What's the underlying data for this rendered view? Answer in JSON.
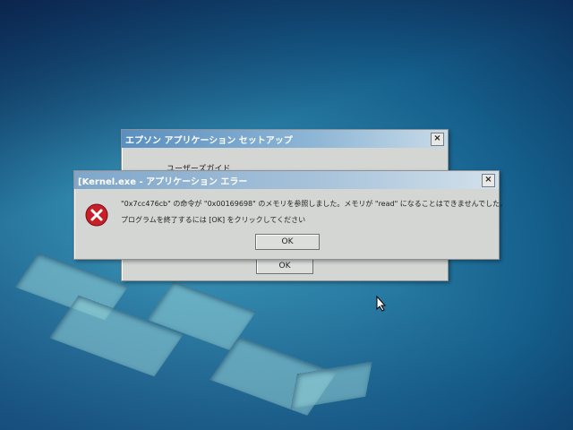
{
  "setup_window": {
    "title": "エプソン アプリケーション セットアップ",
    "label": "ユーザーズガイド",
    "ok_label": "OK",
    "close_glyph": "×"
  },
  "error_dialog": {
    "title": "[Kernel.exe - アプリケーション エラー",
    "message_line1": "\"0x7cc476cb\" の命令が \"0x00169698\" のメモリを参照しました。メモリが \"read\" になることはできませんでした。",
    "message_line2": "プログラムを終了するには [OK] をクリックしてください",
    "ok_label": "OK",
    "close_glyph": "×",
    "icon": "error-icon",
    "icon_color": "#c8202a"
  },
  "desktop": {
    "cursor_icon": "mouse-pointer-icon"
  }
}
